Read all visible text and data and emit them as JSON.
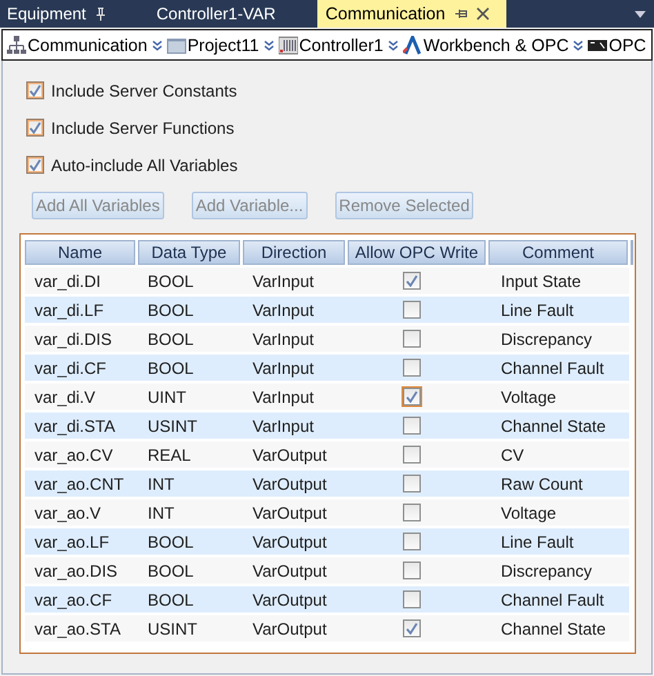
{
  "tabs": [
    {
      "label": "Equipment",
      "selected": false,
      "pinned": true
    },
    {
      "label": "Controller1-VAR",
      "selected": false,
      "pinned": false
    },
    {
      "label": "Communication",
      "selected": true,
      "pinned": true
    }
  ],
  "breadcrumb": [
    {
      "label": "Communication",
      "kind": "network"
    },
    {
      "label": "Project11",
      "kind": "folder"
    },
    {
      "label": "Controller1",
      "kind": "controller"
    },
    {
      "label": "Workbench & OPC",
      "kind": "workbench"
    },
    {
      "label": "OPC",
      "kind": "opc"
    }
  ],
  "options": [
    {
      "label": "Include Server Constants",
      "checked": true
    },
    {
      "label": "Include Server Functions",
      "checked": true
    },
    {
      "label": "Auto-include All Variables",
      "checked": true
    }
  ],
  "buttons": [
    {
      "label": "Add All Variables",
      "disabled": true
    },
    {
      "label": "Add Variable...",
      "disabled": true
    },
    {
      "label": "Remove Selected",
      "disabled": true
    }
  ],
  "table": {
    "columns": [
      "Name",
      "Data Type",
      "Direction",
      "Allow OPC Write",
      "Comment"
    ],
    "rows": [
      {
        "name": "var_di.DI",
        "type": "BOOL",
        "direction": "VarInput",
        "allow_write": true,
        "focused": false,
        "comment": "Input State"
      },
      {
        "name": "var_di.LF",
        "type": "BOOL",
        "direction": "VarInput",
        "allow_write": false,
        "focused": false,
        "comment": "Line Fault"
      },
      {
        "name": "var_di.DIS",
        "type": "BOOL",
        "direction": "VarInput",
        "allow_write": false,
        "focused": false,
        "comment": "Discrepancy"
      },
      {
        "name": "var_di.CF",
        "type": "BOOL",
        "direction": "VarInput",
        "allow_write": false,
        "focused": false,
        "comment": "Channel Fault"
      },
      {
        "name": "var_di.V",
        "type": "UINT",
        "direction": "VarInput",
        "allow_write": true,
        "focused": true,
        "comment": "Voltage"
      },
      {
        "name": "var_di.STA",
        "type": "USINT",
        "direction": "VarInput",
        "allow_write": false,
        "focused": false,
        "comment": "Channel State"
      },
      {
        "name": "var_ao.CV",
        "type": "REAL",
        "direction": "VarOutput",
        "allow_write": false,
        "focused": false,
        "comment": "CV"
      },
      {
        "name": "var_ao.CNT",
        "type": "INT",
        "direction": "VarOutput",
        "allow_write": false,
        "focused": false,
        "comment": "Raw Count"
      },
      {
        "name": "var_ao.V",
        "type": "INT",
        "direction": "VarOutput",
        "allow_write": false,
        "focused": false,
        "comment": "Voltage"
      },
      {
        "name": "var_ao.LF",
        "type": "BOOL",
        "direction": "VarOutput",
        "allow_write": false,
        "focused": false,
        "comment": "Line Fault"
      },
      {
        "name": "var_ao.DIS",
        "type": "BOOL",
        "direction": "VarOutput",
        "allow_write": false,
        "focused": false,
        "comment": "Discrepancy"
      },
      {
        "name": "var_ao.CF",
        "type": "BOOL",
        "direction": "VarOutput",
        "allow_write": false,
        "focused": false,
        "comment": "Channel Fault"
      },
      {
        "name": "var_ao.STA",
        "type": "USINT",
        "direction": "VarOutput",
        "allow_write": true,
        "focused": false,
        "comment": "Channel State"
      }
    ]
  }
}
